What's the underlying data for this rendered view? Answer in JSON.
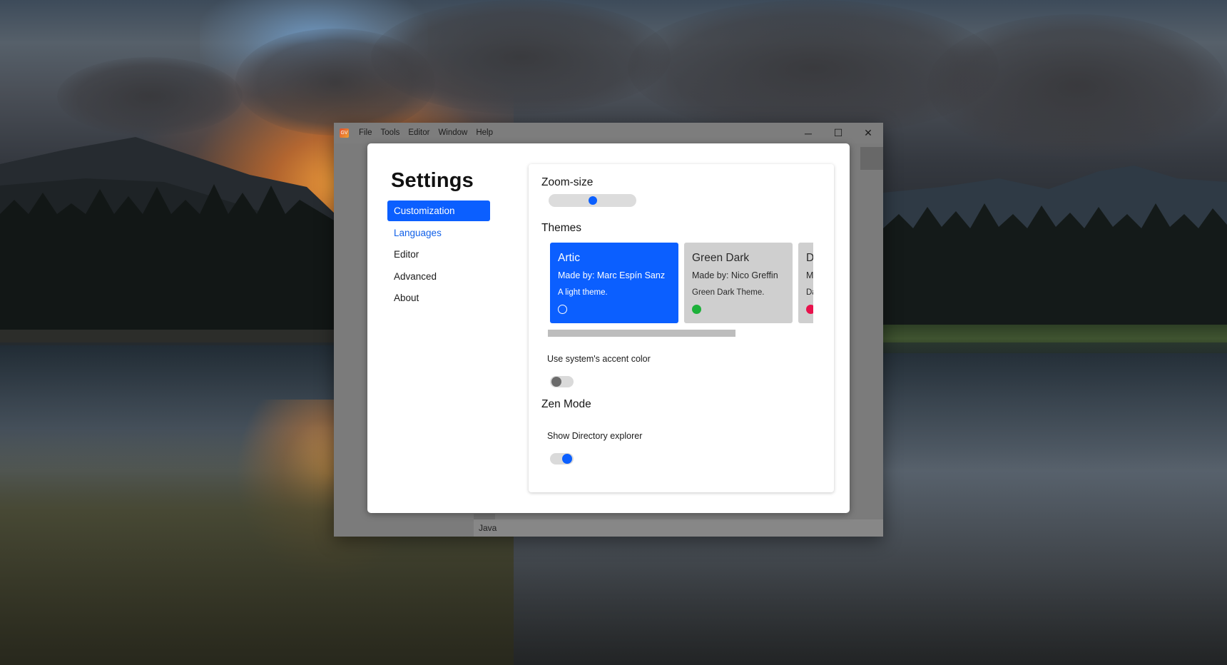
{
  "window": {
    "menu": [
      "File",
      "Tools",
      "Editor",
      "Window",
      "Help"
    ],
    "controls": {
      "minimize": "─",
      "maximize": "☐",
      "close": "✕"
    },
    "status_language": "Java",
    "app_icon_text": "GV"
  },
  "settings": {
    "title": "Settings",
    "nav": [
      {
        "label": "Customization",
        "state": "active"
      },
      {
        "label": "Languages",
        "state": "hover"
      },
      {
        "label": "Editor",
        "state": "normal"
      },
      {
        "label": "Advanced",
        "state": "normal"
      },
      {
        "label": "About",
        "state": "normal"
      }
    ],
    "zoom": {
      "label": "Zoom-size",
      "value_fraction": 0.5
    },
    "themes": {
      "label": "Themes",
      "items": [
        {
          "name": "Artic",
          "author": "Made by: Marc Espín Sanz",
          "description": "A light theme.",
          "accent": "#ffffff",
          "selected": true
        },
        {
          "name": "Green Dark",
          "author": "Made by: Nico Greffin",
          "description": "Green Dark Theme.",
          "accent": "#1db13a",
          "selected": false
        },
        {
          "name": "D",
          "author": "M",
          "description": "Da",
          "accent": "#e8124c",
          "selected": false
        }
      ]
    },
    "accent_option": {
      "label": "Use system's accent color",
      "enabled": false
    },
    "zen_mode": {
      "label": "Zen Mode",
      "directory_explorer": {
        "label": "Show Directory explorer",
        "enabled": true
      }
    }
  },
  "colors": {
    "accent": "#0b5fff",
    "toggle_off_knob": "#6b6b6b"
  }
}
